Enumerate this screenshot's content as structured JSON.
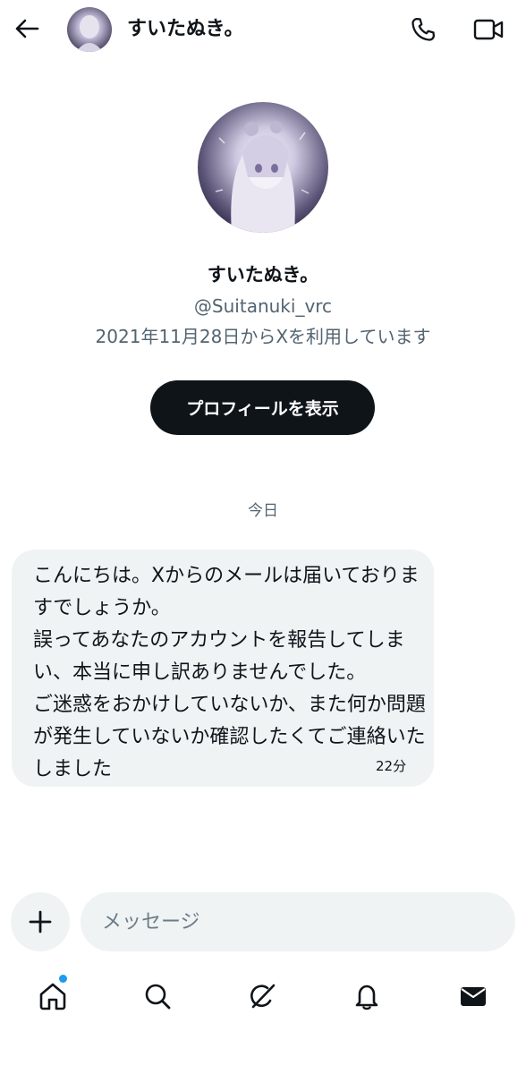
{
  "header": {
    "back_icon": "arrow-left-icon",
    "name": "すいたぬき。",
    "call_icon": "phone-icon",
    "video_icon": "video-camera-icon"
  },
  "profile": {
    "name": "すいたぬき。",
    "handle": "@Suitanuki_vrc",
    "joined": "2021年11月28日からXを利用しています",
    "view_profile_label": "プロフィールを表示"
  },
  "conversation": {
    "day_label": "今日",
    "messages": [
      {
        "text": "こんにちは。Xからのメールは届いておりますでしょうか。\n誤ってあなたのアカウントを報告してしまい、本当に申し訳ありませんでした。\nご迷惑をおかけしていないか、また何か問題が発生していないか確認したくてご連絡いたしました",
        "time": "22分"
      }
    ]
  },
  "composer": {
    "add_icon": "plus-icon",
    "placeholder": "メッセージ"
  },
  "bottom_nav": {
    "items": [
      "home-icon",
      "search-icon",
      "grok-icon",
      "notifications-bell-icon",
      "messages-envelope-icon"
    ],
    "home_has_badge": true,
    "badge_color": "#1d9bf0"
  },
  "colors": {
    "primary_text": "#0f1419",
    "secondary_text": "#536471",
    "bubble_bg": "#eff3f4",
    "button_bg": "#0f1419"
  }
}
